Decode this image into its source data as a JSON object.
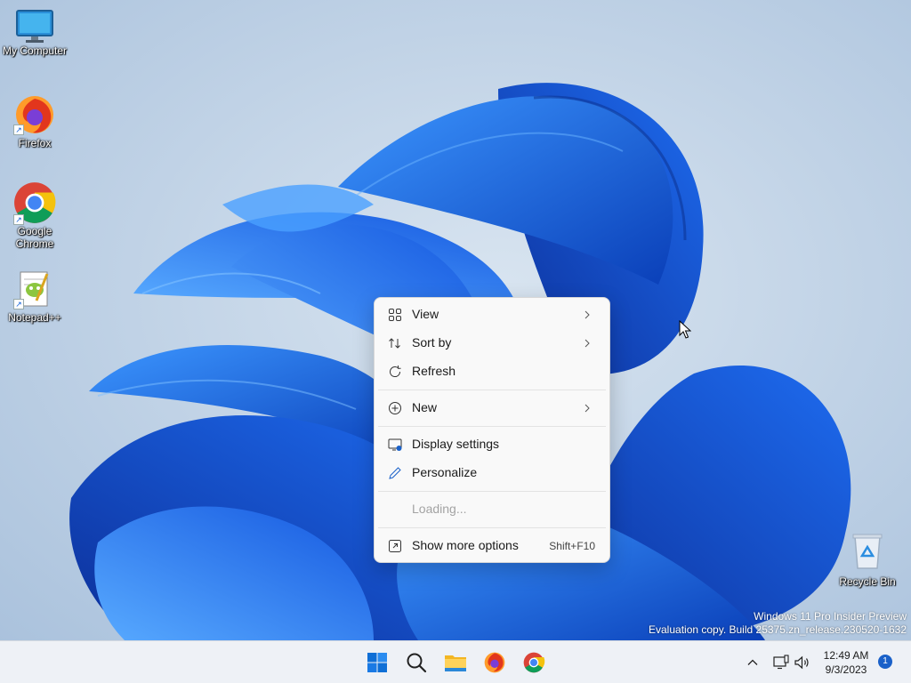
{
  "desktop": {
    "icons": [
      {
        "label": "My Computer",
        "icon": "monitor-icon"
      },
      {
        "label": "Firefox",
        "icon": "firefox-icon"
      },
      {
        "label": "Google Chrome",
        "icon": "chrome-icon"
      },
      {
        "label": "Notepad++",
        "icon": "notepadpp-icon"
      },
      {
        "label": "Recycle Bin",
        "icon": "recycle-bin-icon"
      }
    ],
    "watermark": {
      "line1": "Windows 11 Pro Insider Preview",
      "line2": "Evaluation copy. Build 25375.zn_release.230520-1632"
    }
  },
  "context_menu": {
    "view": "View",
    "sort_by": "Sort by",
    "refresh": "Refresh",
    "new": "New",
    "display_settings": "Display settings",
    "personalize": "Personalize",
    "loading": "Loading...",
    "show_more_options": "Show more options",
    "show_more_shortcut": "Shift+F10"
  },
  "taskbar": {
    "apps": [
      "start-icon",
      "search-icon",
      "file-explorer-icon",
      "firefox-icon",
      "chrome-icon"
    ],
    "clock_time": "12:49 AM",
    "clock_date": "9/3/2023",
    "notification_count": "1"
  },
  "colors": {
    "accent": "#1a61c9",
    "wallpaper_bg": "#b9cde4",
    "bloom": "#1565e0"
  }
}
